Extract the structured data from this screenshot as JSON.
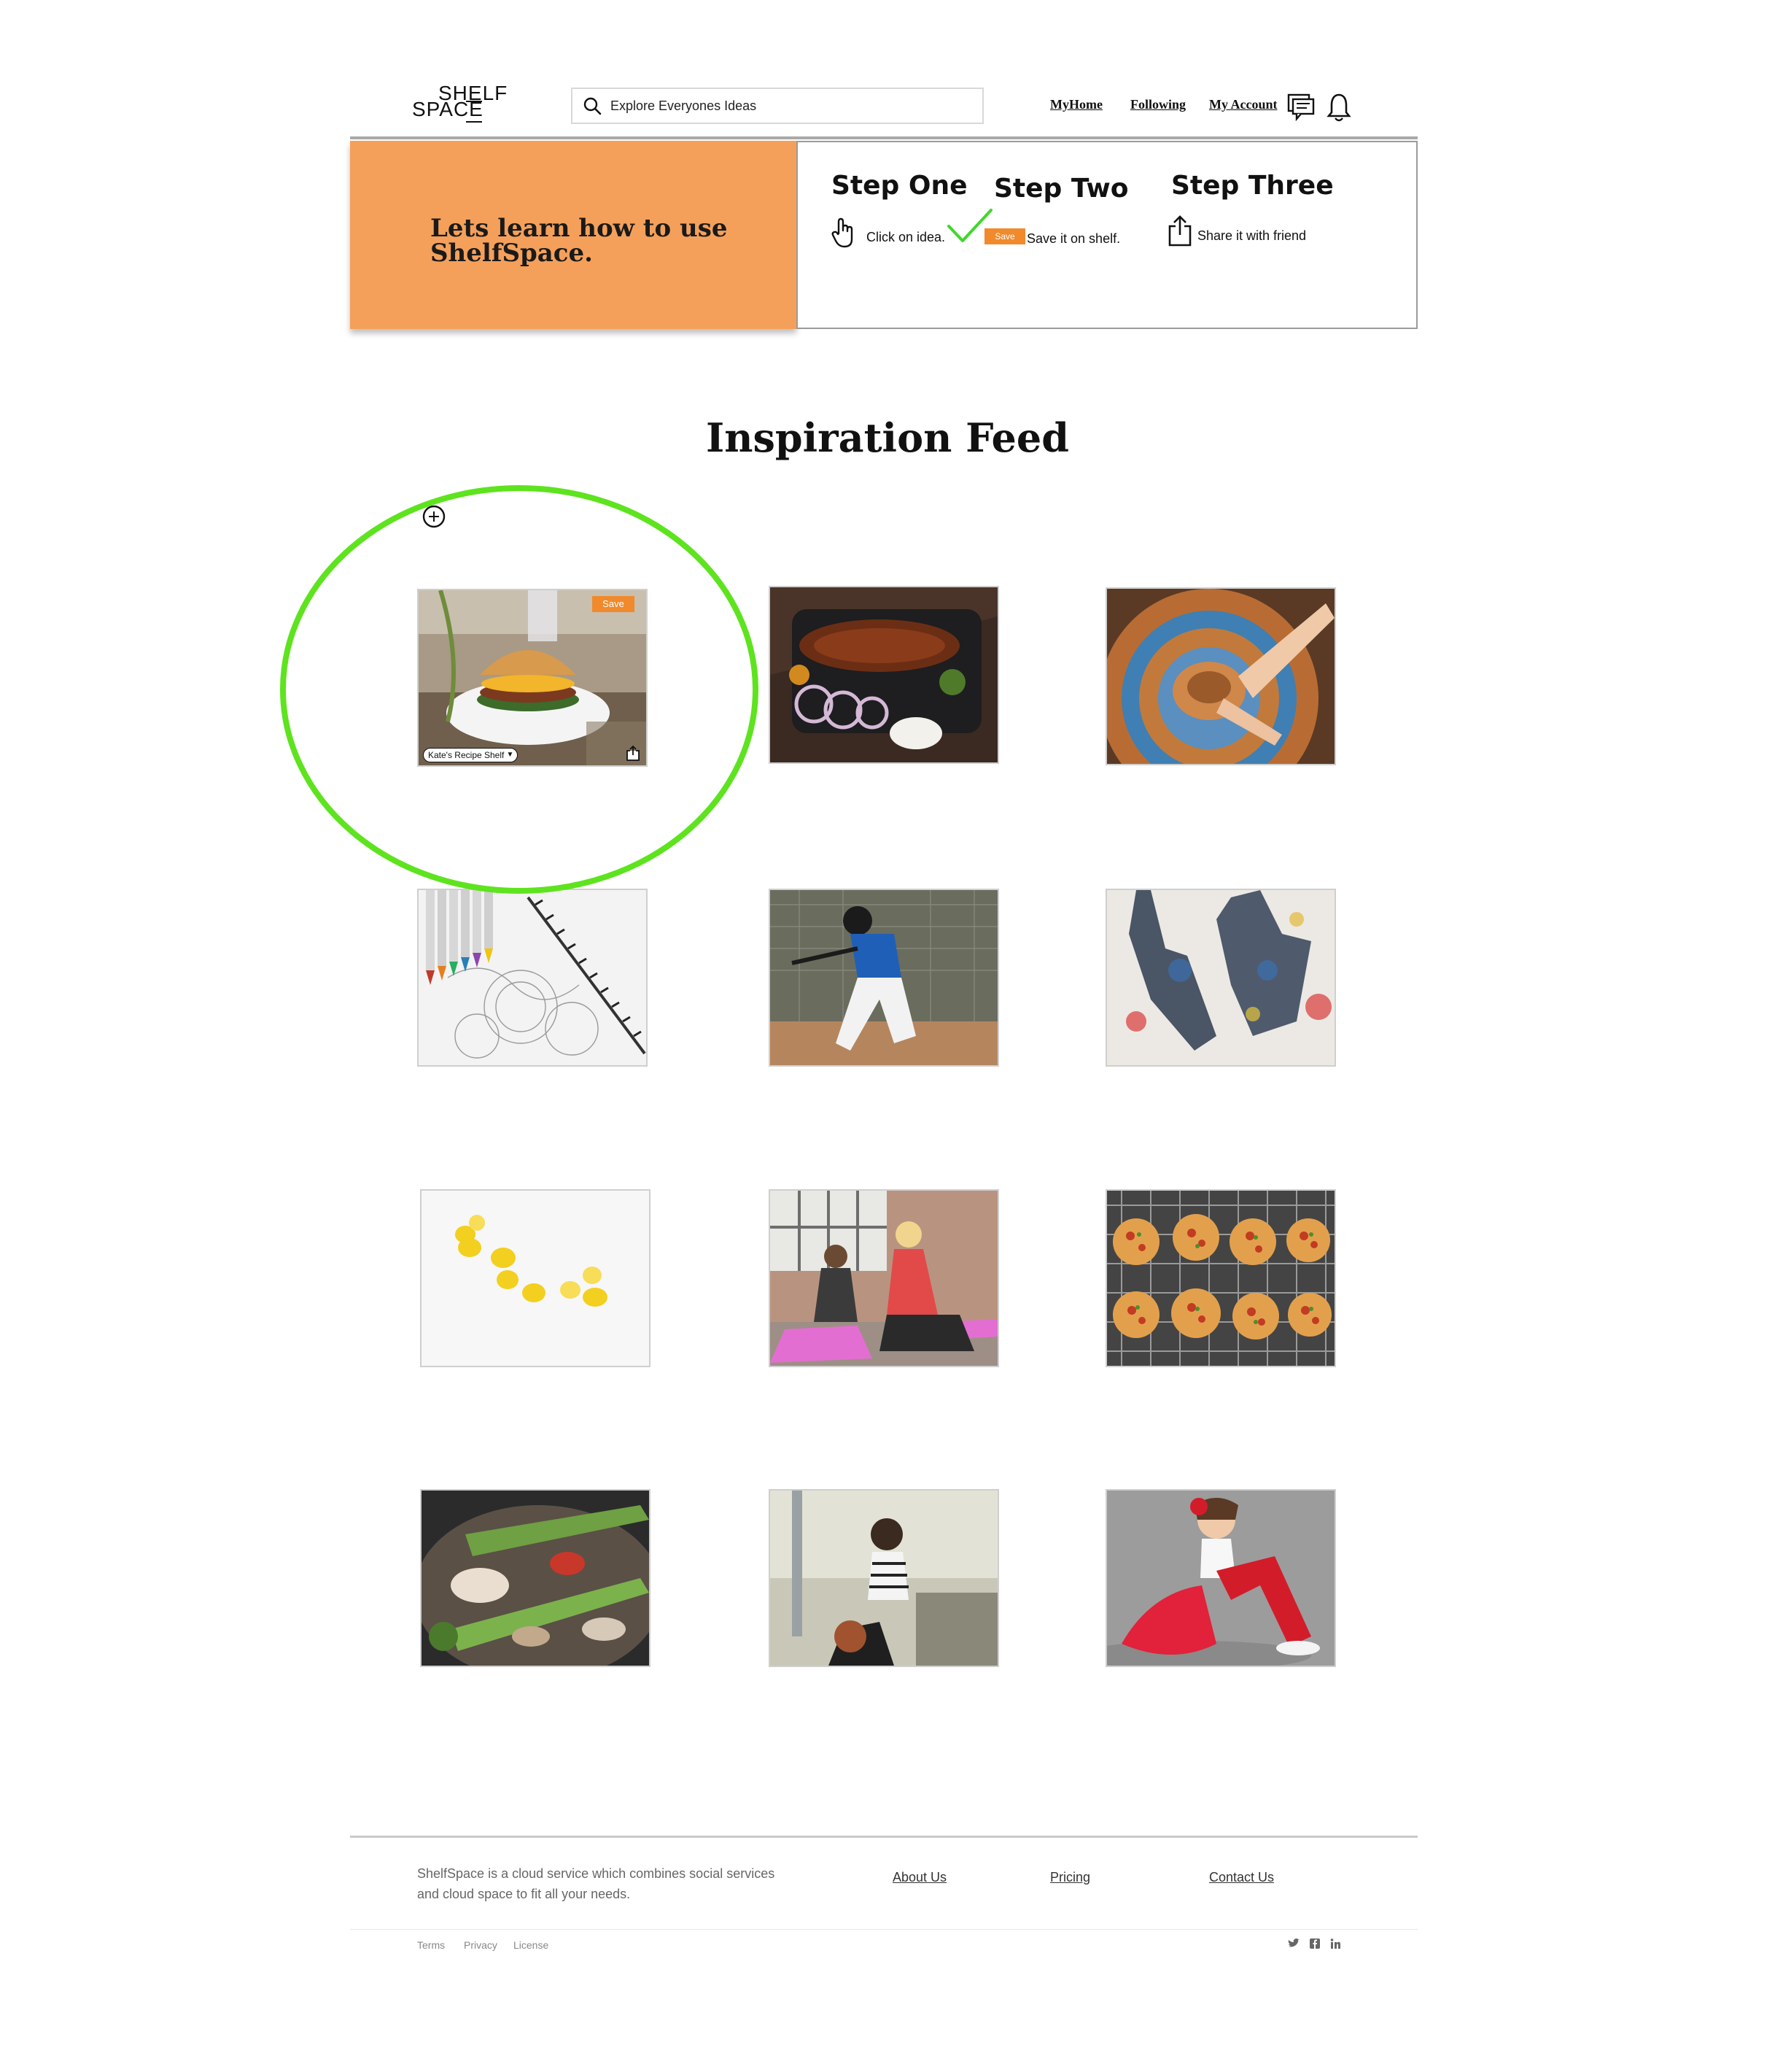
{
  "header": {
    "logo_line1": "SHELF",
    "logo_line2": "SPACE",
    "search_placeholder": "Explore Everyones Ideas",
    "nav": [
      "MyHome",
      "Following",
      "My Account"
    ],
    "icons": [
      "search-icon",
      "chat-icon",
      "bell-icon"
    ]
  },
  "banner": {
    "title": "Lets learn how to use ShelfSpace.",
    "accent_color": "#f5a05a",
    "steps": [
      {
        "title": "Step One",
        "text": "Click on idea.",
        "icon": "pointer-hand-icon"
      },
      {
        "title": "Step Two",
        "text": "Save it on shelf.",
        "chip": "Save",
        "icon": "checkmark-icon"
      },
      {
        "title": "Step Three",
        "text": "Share it with friend",
        "icon": "share-icon"
      }
    ]
  },
  "feed": {
    "title": "Inspiration Feed",
    "highlight_color": "#5ee31f",
    "first_card": {
      "save_label": "Save",
      "shelf_label": "Kate's Recipe Shelf"
    },
    "tiles": [
      {
        "name": "burger"
      },
      {
        "name": "ribs-platter"
      },
      {
        "name": "pottery-wheel"
      },
      {
        "name": "colored-pencils"
      },
      {
        "name": "baseball-batter"
      },
      {
        "name": "painted-hands"
      },
      {
        "name": "lemons"
      },
      {
        "name": "yoga-class"
      },
      {
        "name": "mini-pizzas"
      },
      {
        "name": "stir-fry"
      },
      {
        "name": "mother-child"
      },
      {
        "name": "ballerina-girl"
      }
    ]
  },
  "footer": {
    "description": "ShelfSpace is a cloud service which combines social services and cloud space to fit all your needs.",
    "links": [
      "About Us",
      "Pricing",
      "Contact Us"
    ],
    "legal": [
      "Terms",
      "Privacy",
      "License"
    ],
    "social": [
      "twitter-icon",
      "facebook-icon",
      "linkedin-icon"
    ]
  }
}
